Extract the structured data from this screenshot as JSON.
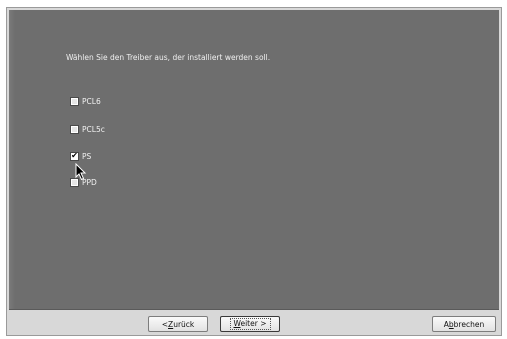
{
  "instruction": "Wählen Sie den Treiber aus, der installiert werden soll.",
  "options": [
    {
      "label": "PCL6",
      "checked": false
    },
    {
      "label": "PCL5c",
      "checked": false
    },
    {
      "label": "PS",
      "checked": true
    },
    {
      "label": "PPD",
      "checked": false
    }
  ],
  "buttons": {
    "back": {
      "prefix": "< ",
      "mnemonic": "Z",
      "rest": "urück"
    },
    "next": {
      "mnemonic": "W",
      "rest": "eiter >"
    },
    "cancel": {
      "before": "A",
      "mnemonic": "b",
      "rest": "brechen"
    }
  },
  "check_glyph": "✔"
}
